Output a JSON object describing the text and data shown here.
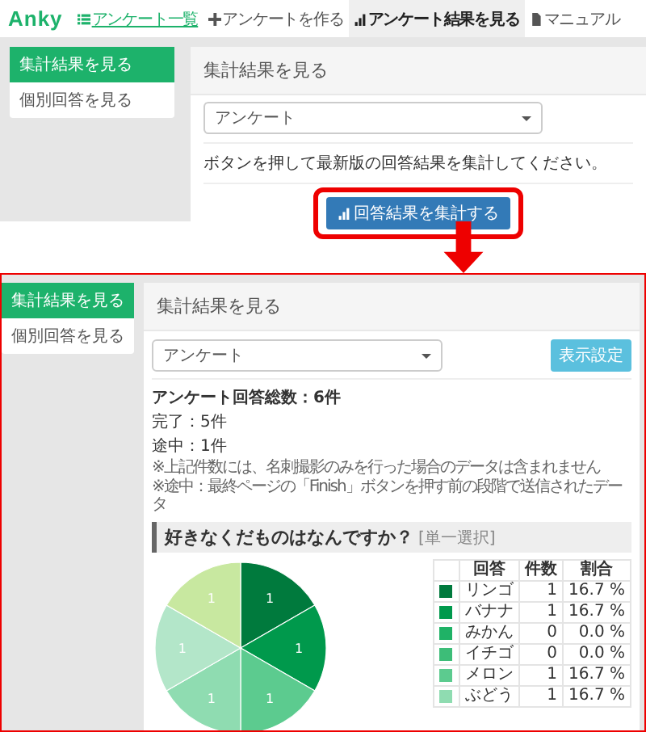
{
  "before": {
    "brand": "Anky",
    "nav": [
      {
        "label": "アンケート一覧",
        "kind": "link",
        "selected": false
      },
      {
        "label": "アンケートを作る",
        "kind": "item",
        "selected": false
      },
      {
        "label": "アンケート結果を見る",
        "kind": "item",
        "selected": true
      },
      {
        "label": "マニュアル",
        "kind": "item",
        "selected": false
      }
    ],
    "sidebar": [
      {
        "label": "集計結果を見る",
        "selected": true
      },
      {
        "label": "個別回答を見る",
        "selected": false
      }
    ],
    "panel": {
      "title": "集計結果を見る",
      "select": "アンケート",
      "message": "ボタンを押して最新版の回答結果を集計してください。",
      "button": "回答結果を集計する",
      "highlighted": true
    }
  },
  "after": {
    "sidebar": [
      {
        "label": "集計結果を見る",
        "selected": true
      },
      {
        "label": "個別回答を見る",
        "selected": false
      }
    ],
    "panel": {
      "title": "集計結果を見る",
      "select": "アンケート",
      "settings_button": "表示設定",
      "total": "アンケート回答総数：6件",
      "counts": [
        "完了：5件",
        "途中：1件"
      ],
      "notes": [
        "※上記件数には、名刺撮影のみを行った場合のデータは含まれません",
        "※途中：最終ページの「Finish」ボタンを押す前の段階で送信されたデータ"
      ],
      "question": "好きなくだものはなんですか？",
      "question_type": "[単一選択]",
      "chart_data": {
        "type": "pie",
        "values": [
          1,
          1,
          1,
          1,
          1,
          1
        ],
        "data_labels": true
      },
      "table": {
        "columns": [
          "回答",
          "件数",
          "割合"
        ],
        "rows": [
          {
            "answer": "リンゴ",
            "count": "1",
            "share": "16.7 %",
            "color": "#007a3d"
          },
          {
            "answer": "バナナ",
            "count": "1",
            "share": "16.7 %",
            "color": "#00994c"
          },
          {
            "answer": "みかん",
            "count": "0",
            "share": "0.0 %",
            "color": "#1fb266"
          },
          {
            "answer": "イチゴ",
            "count": "0",
            "share": "0.0 %",
            "color": "#3dbd78"
          },
          {
            "answer": "メロン",
            "count": "1",
            "share": "16.7 %",
            "color": "#5ccb8f"
          },
          {
            "answer": "ぶどう",
            "count": "1",
            "share": "16.7 %",
            "color": "#8fdcb1"
          }
        ]
      }
    }
  }
}
